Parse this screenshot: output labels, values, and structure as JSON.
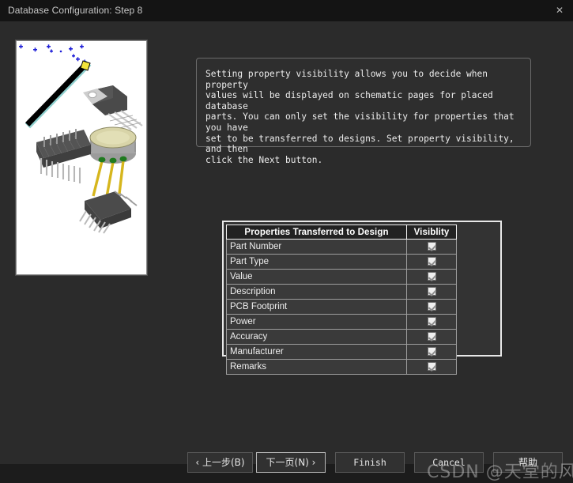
{
  "window": {
    "title": "Database Configuration: Step 8",
    "close_icon": "close-icon",
    "close_glyph": "✕"
  },
  "instructions": {
    "text": "Setting property visibility allows you to decide when property\nvalues will be displayed on schematic pages for placed database\nparts. You can only set the visibility for properties that you have\nset to be transferred to designs. Set property visibility, and then\nclick the Next button."
  },
  "illustration": {
    "name": "wizard-components-illustration",
    "alt": "Magic wand with blue sparkles over electronic component packages (TO-220, TO-5 can, DIP, SOIC)",
    "colors": {
      "background": "#ffffff",
      "sparkle": "#1f1fd8",
      "wand_body": "#000000",
      "wand_tip": "#f2e43b",
      "package_dark": "#4d4d4d",
      "package_mid": "#6e6e6e",
      "lead_gold": "#d6b61d",
      "can_top": "#d8d4a8",
      "lead_green": "#1f7a1f"
    }
  },
  "table": {
    "headers": {
      "property": "Properties Transferred to Design",
      "visibility": "Visiblity"
    },
    "rows": [
      {
        "property": "Part Number",
        "visible": true
      },
      {
        "property": "Part Type",
        "visible": true
      },
      {
        "property": "Value",
        "visible": true
      },
      {
        "property": "Description",
        "visible": true
      },
      {
        "property": "PCB Footprint",
        "visible": true
      },
      {
        "property": "Power",
        "visible": true
      },
      {
        "property": "Accuracy",
        "visible": true
      },
      {
        "property": "Manufacturer",
        "visible": true
      },
      {
        "property": "Remarks",
        "visible": true
      }
    ]
  },
  "buttons": {
    "back": "‹ 上一步(B)",
    "next": "下一页(N) ›",
    "finish": "Finish",
    "cancel": "Cancel",
    "help": "帮助"
  },
  "watermark": {
    "text": "CSDN @天堂的风声"
  }
}
